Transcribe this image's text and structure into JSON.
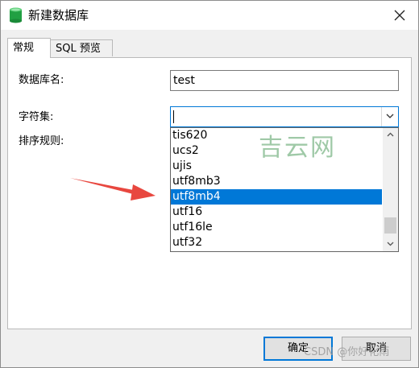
{
  "window": {
    "title": "新建数据库"
  },
  "tabs": [
    {
      "label": "常规",
      "active": true
    },
    {
      "label": "SQL 预览",
      "active": false
    }
  ],
  "form": {
    "db_name_label": "数据库名:",
    "db_name_value": "test",
    "charset_label": "字符集:",
    "charset_value": "",
    "collation_label": "排序规则:"
  },
  "charset_options": [
    "tis620",
    "ucs2",
    "ujis",
    "utf8mb3",
    "utf8mb4",
    "utf16",
    "utf16le",
    "utf32"
  ],
  "charset_highlighted": "utf8mb4",
  "buttons": {
    "ok": "确定",
    "cancel": "取消"
  },
  "watermarks": {
    "site": "吉云网",
    "csdn": "CSDN @你好化雨"
  },
  "colors": {
    "selection": "#0078d7",
    "arrow": "#e8473f",
    "watermark": "#7fb88a"
  },
  "icons": {
    "app": "database-icon",
    "close": "close-icon",
    "combo": "chevron-down-icon",
    "scroll_up": "chevron-up-icon",
    "scroll_down": "chevron-down-icon"
  }
}
